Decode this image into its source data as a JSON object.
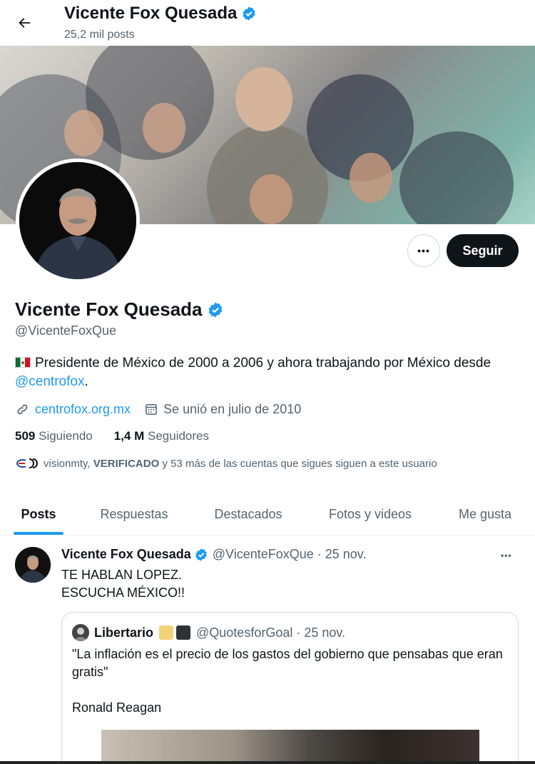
{
  "header": {
    "name": "Vicente Fox Quesada",
    "post_count": "25,2 mil posts"
  },
  "profile": {
    "name": "Vicente Fox Quesada",
    "handle": "@VicenteFoxQue",
    "bio_text": "Presidente de México de 2000 a 2006 y ahora trabajando por México desde",
    "bio_mention": "@centrofox",
    "bio_end": ".",
    "website": "centrofox.org.mx",
    "joined": "Se unió en julio de 2010",
    "following_count": "509",
    "following_label": "Siguiendo",
    "followers_count": "1,4 M",
    "followers_label": "Seguidores",
    "fyk_name": "visionmty,",
    "fyk_verified": "VERIFICADO",
    "fyk_rest": "y 53 más de las cuentas que sigues siguen a este usuario"
  },
  "actions": {
    "more_label": "•••",
    "follow_label": "Seguir"
  },
  "tabs": [
    {
      "label": "Posts",
      "active": true
    },
    {
      "label": "Respuestas",
      "active": false
    },
    {
      "label": "Destacados",
      "active": false
    },
    {
      "label": "Fotos y videos",
      "active": false
    },
    {
      "label": "Me gusta",
      "active": false
    }
  ],
  "tweet": {
    "author": "Vicente Fox Quesada",
    "handle_date": "@VicenteFoxQue · 25 nov.",
    "line1": "TE HABLAN LOPEZ.",
    "line2": "ESCUCHA MÉXICO!!",
    "more_label": "•••",
    "quote": {
      "author": "Libertario",
      "handle_date": "@QuotesforGoal · 25 nov.",
      "text": "\"La inflación es el precio de los gastos del gobierno que pensabas que eran gratis\"\n\nRonald Reagan"
    }
  },
  "colors": {
    "accent": "#1d9bf0",
    "text": "#0f1419",
    "muted": "#536471",
    "verified": "#1d9bf0",
    "follow_bg": "#0f1419",
    "square_yellow": "#f3d37a",
    "square_dark": "#2f3336"
  },
  "icons": {
    "back": "arrow-left-icon",
    "verified": "verified-badge-icon",
    "link": "link-icon",
    "calendar": "calendar-icon",
    "more": "more-horizontal-icon"
  }
}
